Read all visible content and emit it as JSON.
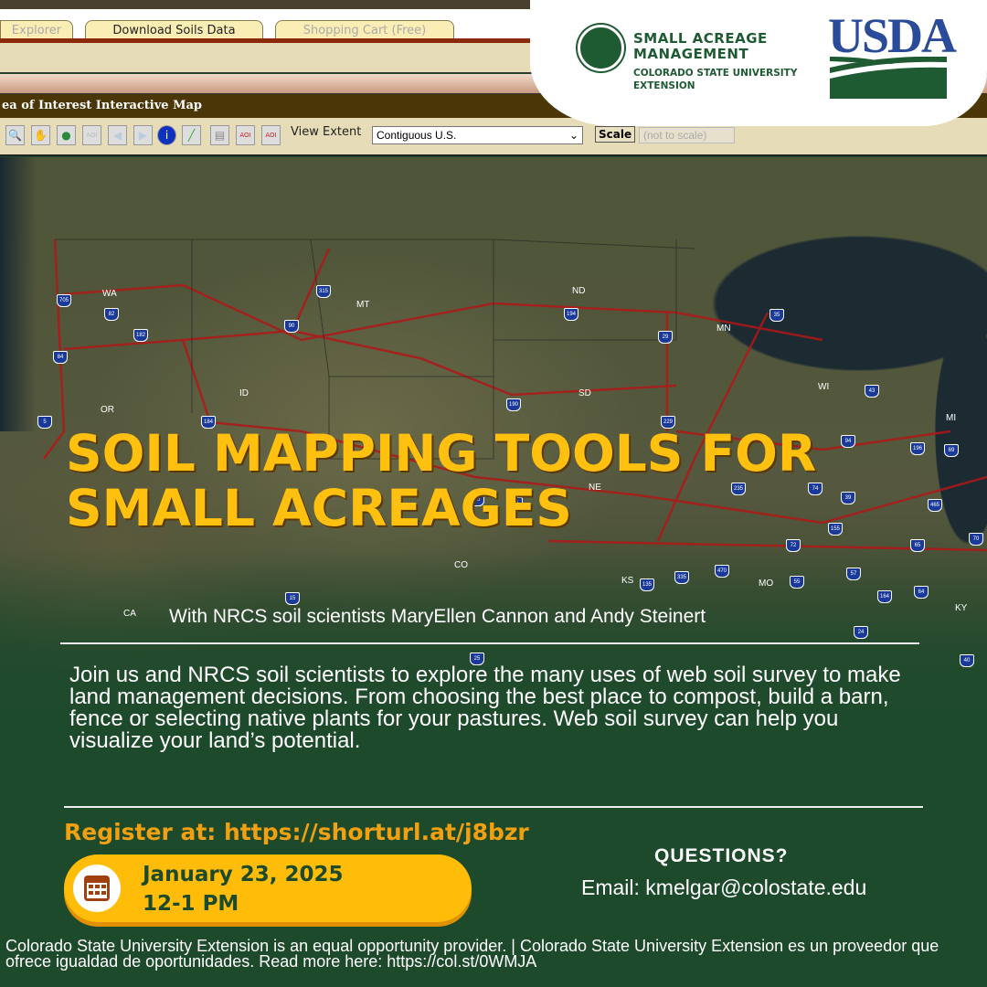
{
  "browser": {
    "tabs": [
      {
        "label": "Explorer"
      },
      {
        "label": "Download Soils Data"
      },
      {
        "label": "Shopping Cart (Free)"
      }
    ],
    "map_title": "ea of Interest Interactive Map",
    "toolbar": {
      "view_extent_label": "View Extent",
      "view_extent_value": "Contiguous U.S.",
      "scale_button": "Scale",
      "scale_value": "(not to scale)"
    }
  },
  "map": {
    "states": [
      "WA",
      "MT",
      "ND",
      "MN",
      "OR",
      "ID",
      "SD",
      "WI",
      "MI",
      "NE",
      "CO",
      "KS",
      "MO",
      "CA",
      "KY"
    ],
    "interstates": [
      "705",
      "82",
      "182",
      "84",
      "5",
      "315",
      "90",
      "184",
      "194",
      "29",
      "35",
      "190",
      "229",
      "94",
      "43",
      "196",
      "69",
      "80",
      "76",
      "235",
      "74",
      "39",
      "465",
      "65",
      "70",
      "72",
      "155",
      "57",
      "64",
      "135",
      "335",
      "470",
      "55",
      "24",
      "164",
      "15",
      "25",
      "40"
    ]
  },
  "logos": {
    "sam_line1": "SMALL ACREAGE",
    "sam_line2": "MANAGEMENT",
    "csu_line1": "COLORADO STATE UNIVERSITY",
    "csu_line2": "EXTENSION",
    "usda": "USDA"
  },
  "flyer": {
    "title_line1": "Soil Mapping Tools for",
    "title_line2": "Small Acreages",
    "subtitle": "With NRCS soil scientists MaryEllen Cannon and Andy Steinert",
    "body": "Join us and NRCS soil scientists to explore the many uses of web soil survey to make land management decisions. From choosing the best place to compost, build a barn, fence or selecting native plants for your pastures. Web soil survey can help you visualize your land’s potential.",
    "register": "Register at: https://shorturl.at/j8bzr",
    "date": "January 23, 2025",
    "time": "12-1 PM",
    "questions": "QUESTIONS?",
    "email": "Email: kmelgar@colostate.edu",
    "footer": "Colorado State University Extension is an equal opportunity provider. | Colorado State University Extension es un proveedor que ofrece igualdad de oportunidades. Read more here: https://col.st/0WMJA"
  },
  "colors": {
    "green": "#1e4a2c",
    "gold": "#ffbc08",
    "title": "#ffc010",
    "usda_blue": "#2a4a9a"
  }
}
